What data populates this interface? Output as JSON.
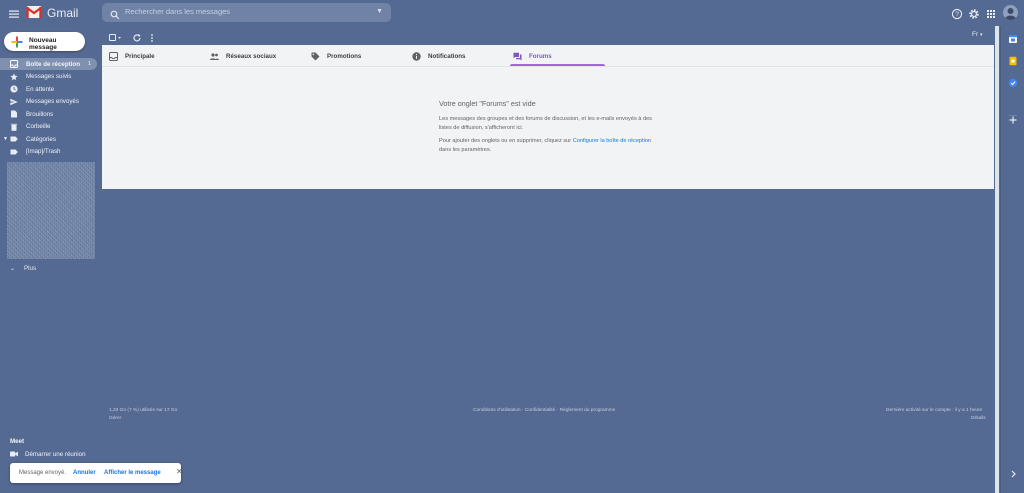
{
  "header": {
    "app_name": "Gmail",
    "search_placeholder": "Rechercher dans les messages"
  },
  "sidebar": {
    "compose_label": "Nouveau message",
    "items": [
      {
        "label": "Boîte de réception",
        "count": "1",
        "icon": "inbox-icon"
      },
      {
        "label": "Messages suivis",
        "icon": "star-icon"
      },
      {
        "label": "En attente",
        "icon": "clock-icon"
      },
      {
        "label": "Messages envoyés",
        "icon": "send-icon"
      },
      {
        "label": "Brouillons",
        "icon": "draft-icon"
      },
      {
        "label": "Corbeille",
        "icon": "trash-icon"
      },
      {
        "label": "Catégories",
        "icon": "label-icon"
      },
      {
        "label": "[Imap]/Trash",
        "icon": "label-icon"
      }
    ],
    "more_label": "Plus"
  },
  "meet": {
    "title": "Meet",
    "start_label": "Démarrer une réunion"
  },
  "toast": {
    "message": "Message envoyé.",
    "undo": "Annuler",
    "view": "Afficher le message"
  },
  "toolbar": {
    "lang": "Fr"
  },
  "tabs": [
    {
      "label": "Principale",
      "icon": "inbox-icon"
    },
    {
      "label": "Réseaux sociaux",
      "icon": "people-icon"
    },
    {
      "label": "Promotions",
      "icon": "tag-icon"
    },
    {
      "label": "Notifications",
      "icon": "info-icon"
    },
    {
      "label": "Forums",
      "icon": "forum-icon",
      "active": true
    }
  ],
  "empty": {
    "title": "Votre onglet \"Forums\" est vide",
    "p1": "Les messages des groupes et des forums de discussion, et les e-mails envoyés à des listes de diffusion, s'afficheront ici.",
    "p2_before": "Pour ajouter des onglets ou en supprimer, cliquez sur ",
    "p2_link": "Configurer la boîte de réception",
    "p2_after": " dans les paramètres."
  },
  "footer": {
    "storage": "1,33 Go (7 %) utilisés sur 17 Go",
    "manage": "Gérer",
    "terms": "Conditions d'utilisation",
    "privacy": "Confidentialité",
    "policy": "Règlement du programme",
    "sep": "·",
    "activity": "Dernière activité sur le compte : il y a 1 heure",
    "details": "Détails"
  },
  "colors": {
    "background": "#556a93",
    "panel": "#f2f3f5",
    "active_tab": "#7e57c2",
    "link": "#1a73e8"
  }
}
